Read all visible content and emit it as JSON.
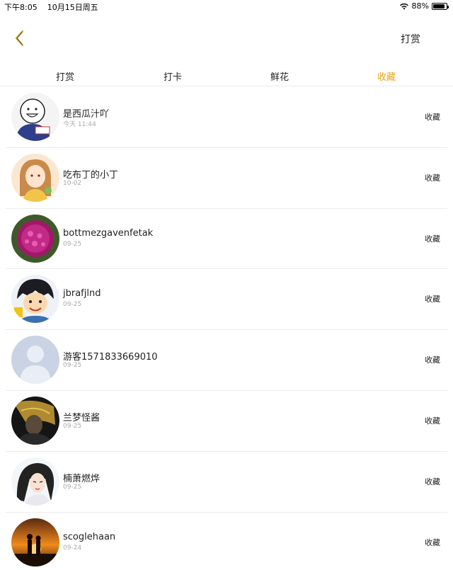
{
  "status_bar": {
    "time": "下午8:05",
    "date": "10月15日周五",
    "battery": "88%",
    "battery_level": 0.88
  },
  "nav": {
    "back_icon": "chevron-left-icon",
    "action_label": "打赏",
    "accent_color": "#e8a31a"
  },
  "tabs": [
    {
      "label": "打赏",
      "active": false
    },
    {
      "label": "打卡",
      "active": false
    },
    {
      "label": "鲜花",
      "active": false
    },
    {
      "label": "收藏",
      "active": true
    }
  ],
  "list": [
    {
      "name": "是西瓜汁吖",
      "time": "今天 11:44",
      "action": "收藏"
    },
    {
      "name": "吃布丁的小丁",
      "time": "10-02",
      "action": "收藏"
    },
    {
      "name": "bottmezgavenfetak",
      "time": "09-25",
      "action": "收藏"
    },
    {
      "name": "jbrafjlnd",
      "time": "09-25",
      "action": "收藏"
    },
    {
      "name": "游客1571833669010",
      "time": "09-25",
      "action": "收藏"
    },
    {
      "name": "兰梦怪酱",
      "time": "09-25",
      "action": "收藏"
    },
    {
      "name": "楠萧燃烨",
      "time": "09-25",
      "action": "收藏"
    },
    {
      "name": "scoglehaan",
      "time": "09-24",
      "action": "收藏"
    }
  ]
}
